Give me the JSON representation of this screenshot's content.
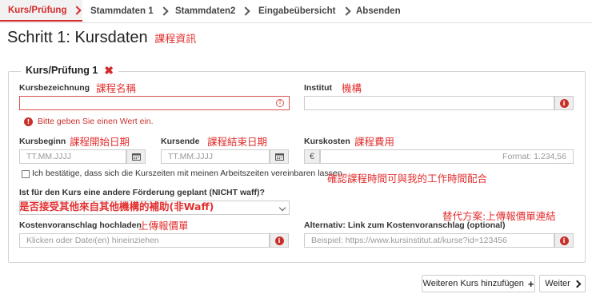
{
  "tabs": [
    {
      "label": "Kurs/Prüfung"
    },
    {
      "label": "Stammdaten 1"
    },
    {
      "label": "Stammdaten2"
    },
    {
      "label": "Eingabeübersicht"
    },
    {
      "label": "Absenden"
    }
  ],
  "page": {
    "title": "Schritt 1: Kursdaten",
    "title_note": "課程資訊"
  },
  "course": {
    "legend": "Kurs/Prüfung 1",
    "remove_icon": "close-icon"
  },
  "fields": {
    "kursbezeichnung": {
      "label": "Kursbezeichnung",
      "note": "課程名稱",
      "value": "",
      "error": "Bitte geben Sie einen Wert ein."
    },
    "institut": {
      "label": "Institut",
      "note": "機構",
      "value": ""
    },
    "kursbeginn": {
      "label": "Kursbeginn",
      "note": "課程開始日期",
      "placeholder": "TT.MM.JJJJ"
    },
    "kursende": {
      "label": "Kursende",
      "note": "課程結束日期",
      "placeholder": "TT.MM.JJJJ"
    },
    "kurskosten": {
      "label": "Kurskosten",
      "note": "課程費用",
      "currency": "€",
      "placeholder": "Format: 1.234,56"
    },
    "confirm": {
      "label": "Ich bestätige, dass sich die Kurszeiten mit meinen Arbeitszeiten vereinbaren lassen",
      "note": "確認課程時間可與我的工作時間配合",
      "checked": false
    },
    "foerderung": {
      "label": "Ist für den Kurs eine andere Förderung geplant (NICHT waff)?",
      "note": "是否接受其他來自其他機構的補助(非Waff)",
      "value": ""
    },
    "kostenvoranschlag": {
      "label": "Kostenvoranschlag hochladen",
      "note": "上傳報價單",
      "placeholder": "Klicken oder Datei(en) hineinziehen"
    },
    "link": {
      "label": "Alternativ: Link zum Kostenvoranschlag (optional)",
      "note": "替代方案:上傳報價單連結",
      "placeholder": "Beispiel: https://www.kursinstitut.at/kurse?id=123456"
    }
  },
  "buttons": {
    "add_course": "Weiteren Kurs hinzufügen",
    "next": "Weiter"
  },
  "colors": {
    "accent": "#d42b2b",
    "annotation": "#e32f2f",
    "error": "#c9302c"
  }
}
